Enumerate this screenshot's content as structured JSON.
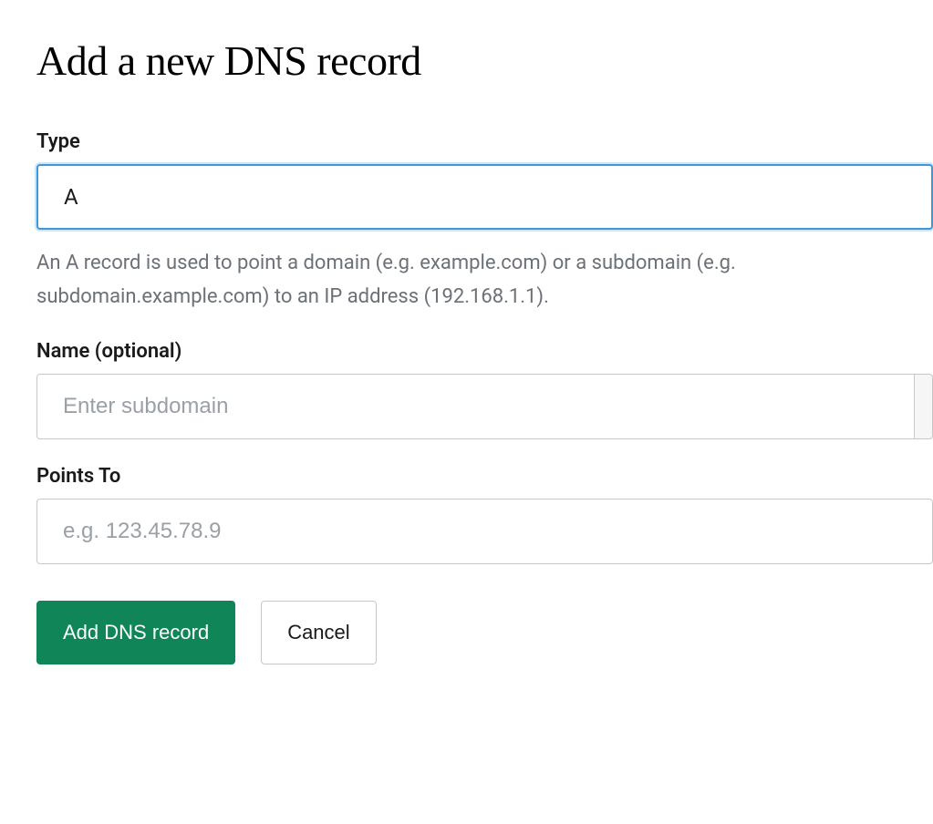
{
  "title": "Add a new DNS record",
  "type_field": {
    "label": "Type",
    "value": "A",
    "hint": "An A record is used to point a domain (e.g. example.com) or a subdomain (e.g. subdomain.example.com) to an IP address (192.168.1.1)."
  },
  "name_field": {
    "label": "Name (optional)",
    "placeholder": "Enter subdomain",
    "value": ""
  },
  "points_to_field": {
    "label": "Points To",
    "placeholder": "e.g. 123.45.78.9",
    "value": ""
  },
  "buttons": {
    "submit": "Add DNS record",
    "cancel": "Cancel"
  }
}
